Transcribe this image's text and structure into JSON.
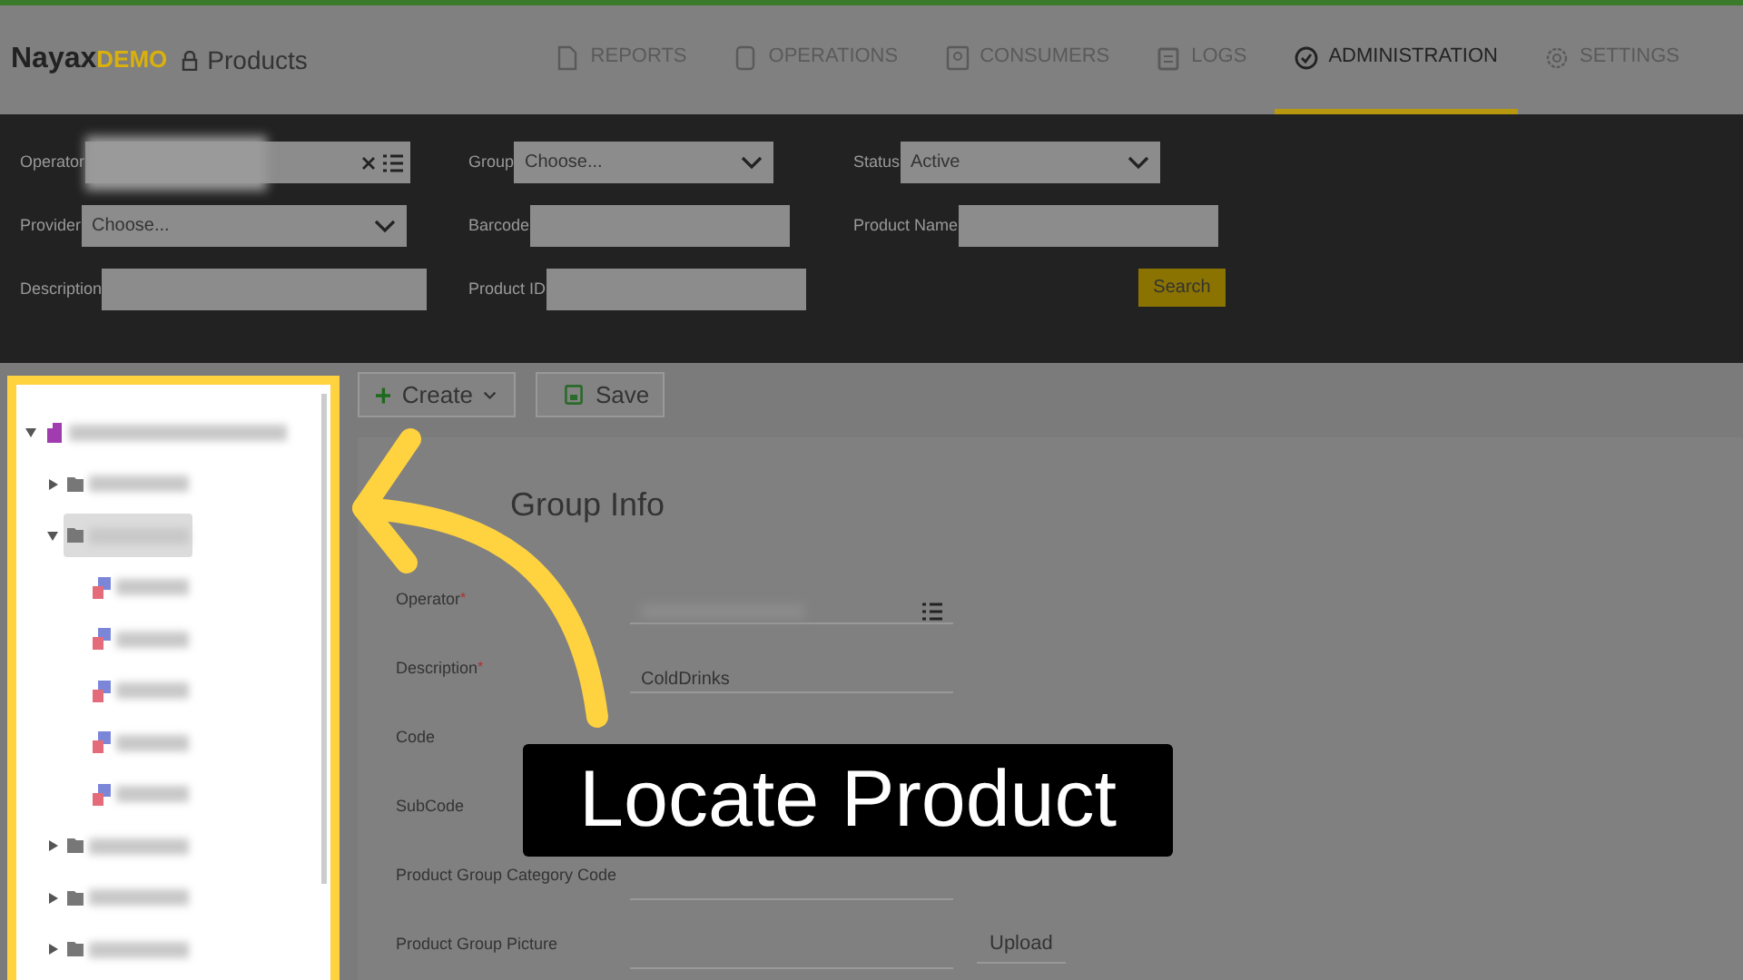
{
  "header": {
    "logo": {
      "brand": "Nayax",
      "suffix": "DEMO"
    },
    "page_title": "Products",
    "nav": [
      {
        "label": "REPORTS",
        "selected": false
      },
      {
        "label": "OPERATIONS",
        "selected": false
      },
      {
        "label": "CONSUMERS",
        "selected": false
      },
      {
        "label": "LOGS",
        "selected": false
      },
      {
        "label": "ADMINISTRATION",
        "selected": true
      },
      {
        "label": "SETTINGS",
        "selected": false
      }
    ]
  },
  "filters": [
    {
      "label": "Operator",
      "kind": "operator"
    },
    {
      "label": "Group",
      "kind": "select",
      "value": "Choose..."
    },
    {
      "label": "Status",
      "kind": "select",
      "value": "Active"
    },
    {
      "label": "Provider",
      "kind": "select",
      "value": "Choose..."
    },
    {
      "label": "Barcode",
      "kind": "text"
    },
    {
      "label": "Product Name",
      "kind": "text"
    },
    {
      "label": "Description",
      "kind": "text"
    },
    {
      "label": "Product ID",
      "kind": "text"
    },
    {
      "kind": "button",
      "label": "Search"
    }
  ],
  "tree": [
    {
      "kind": "root",
      "expanded": true,
      "selected": false,
      "children": [
        {
          "kind": "folder",
          "expanded": false,
          "selected": false
        },
        {
          "kind": "folder",
          "expanded": true,
          "selected": true,
          "children": [
            {
              "kind": "product",
              "selected": false
            },
            {
              "kind": "product",
              "selected": false
            },
            {
              "kind": "product",
              "selected": false
            },
            {
              "kind": "product",
              "selected": false
            },
            {
              "kind": "product",
              "selected": false
            }
          ]
        },
        {
          "kind": "folder",
          "expanded": false,
          "selected": false
        },
        {
          "kind": "folder",
          "expanded": false,
          "selected": false
        },
        {
          "kind": "folder",
          "expanded": false,
          "selected": false
        }
      ]
    }
  ],
  "toolbar": {
    "create": "Create",
    "save": "Save"
  },
  "form": {
    "heading": "Group Info",
    "fields": [
      {
        "label": "Operator",
        "required_mark": "*",
        "kind": "operator"
      },
      {
        "label": "Description",
        "required_mark": "*",
        "kind": "text",
        "value": "ColdDrinks"
      },
      {
        "label": "Code",
        "kind": "text"
      },
      {
        "label": "SubCode",
        "kind": "text"
      },
      {
        "label": "Product Group Category Code",
        "kind": "text"
      },
      {
        "label": "Product Group Picture",
        "kind": "upload",
        "button": "Upload"
      }
    ]
  },
  "callout": {
    "caption": "Locate Product"
  }
}
